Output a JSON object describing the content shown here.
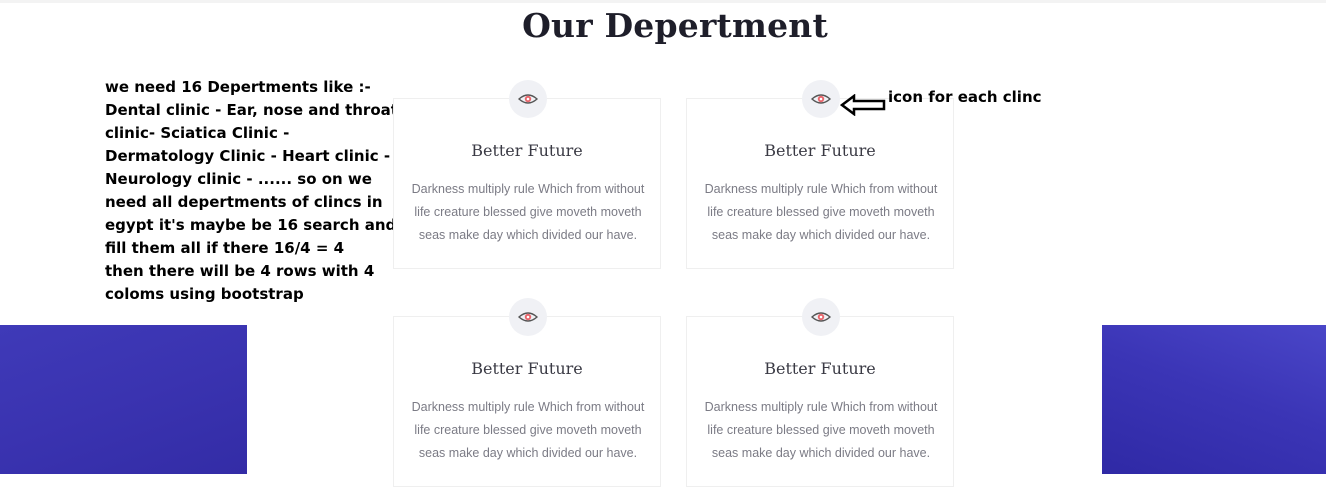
{
  "section": {
    "title": "Our Depertment"
  },
  "note": {
    "text": "we need 16 Depertments like :-\nDental clinic - Ear, nose and throat clinic- Sciatica Clinic - Dermatology Clinic - Heart clinic - Neurology clinic - ...... so on we need all depertments of clincs in egypt it's maybe be 16 search and fill them all if there 16/4 = 4\nthen there will be 4 rows with 4 coloms using bootstrap"
  },
  "annotation": {
    "text": "icon for each clinc"
  },
  "cards": [
    {
      "icon": "eye-icon",
      "title": "Better Future",
      "text": "Darkness multiply rule Which from without life creature blessed give moveth moveth seas make day which divided our have."
    },
    {
      "icon": "eye-icon",
      "title": "Better Future",
      "text": "Darkness multiply rule Which from without life creature blessed give moveth moveth seas make day which divided our have."
    },
    {
      "icon": "eye-icon",
      "title": "Better Future",
      "text": "Darkness multiply rule Which from without life creature blessed give moveth moveth seas make day which divided our have."
    },
    {
      "icon": "eye-icon",
      "title": "Better Future",
      "text": "Darkness multiply rule Which from without life creature blessed give moveth moveth seas make day which divided our have."
    }
  ],
  "colors": {
    "accent_blue": "#3a33b0",
    "icon_accent": "#e8656b"
  }
}
